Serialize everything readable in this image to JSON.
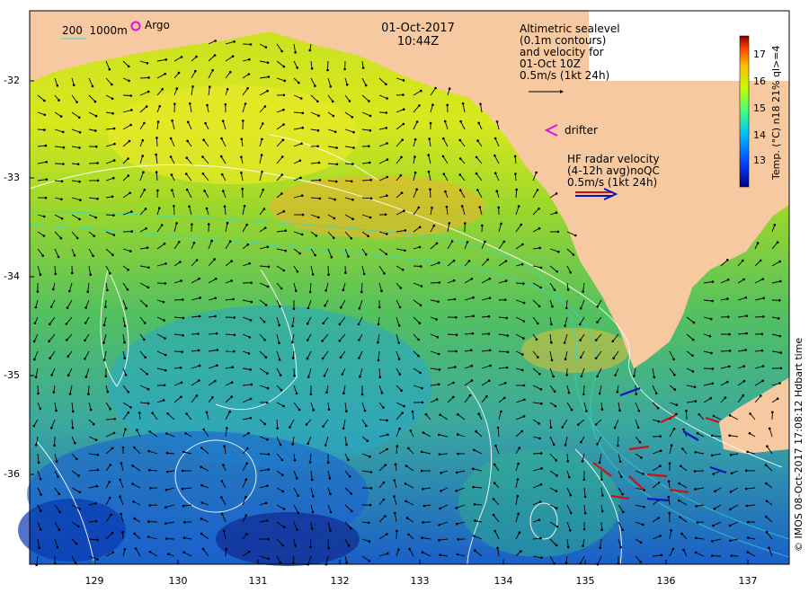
{
  "title": {
    "date": "01-Oct-2017",
    "time": "10:44Z"
  },
  "legend": {
    "isobath_a": "200",
    "isobath_b": "1000m",
    "argo_label": "Argo",
    "drifter_label": "drifter",
    "altimetry_lines": [
      "Altimetric sealevel",
      "(0.1m contours)",
      "and velocity for",
      "01-Oct 10Z",
      "0.5m/s (1kt 24h)"
    ],
    "hf_lines": [
      "HF radar velocity",
      "(4-12h avg)noQC",
      "0.5m/s (1kt 24h)"
    ]
  },
  "colorbar": {
    "ticks": [
      "17",
      "16",
      "15",
      "14",
      "13"
    ],
    "label": "Temp. (°C) n18 21% ql>=4",
    "min": 12,
    "max": 18
  },
  "axes": {
    "x_ticks": [
      "129",
      "130",
      "131",
      "132",
      "133",
      "134",
      "135",
      "136",
      "137"
    ],
    "y_ticks": [
      "-32",
      "-33",
      "-34",
      "-35",
      "-36"
    ]
  },
  "credit": "© IMOS 08-Oct-2017 17:08:12 Hdbart time",
  "colors": {
    "land": "#f7c9a0",
    "arrow": "#000000",
    "hf_red": "#d01010",
    "hf_blue": "#1010c0",
    "contour": "#ffffff",
    "argo": "#e010e0"
  }
}
